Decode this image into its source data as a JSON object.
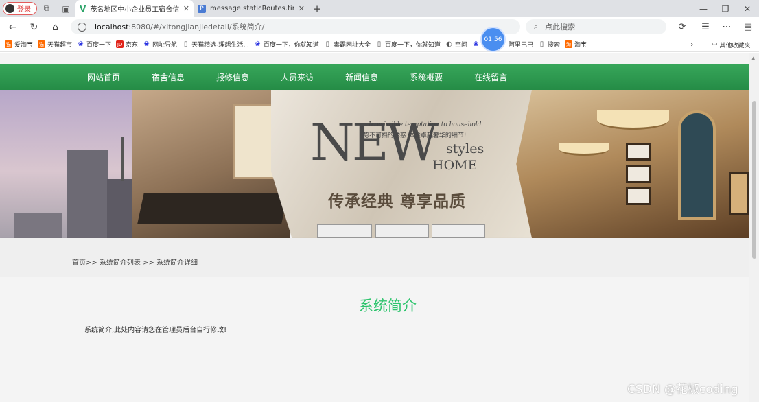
{
  "browser": {
    "login_label": "登录",
    "tabs": [
      {
        "title": "茂名地区中小企业员工宿舍信息管理",
        "active": true
      },
      {
        "title": "message.staticRoutes.tinymceEdit",
        "active": false
      }
    ],
    "url": {
      "host": "localhost",
      "path": ":8080/#/xitongjianjiedetail/系统简介/"
    },
    "search_placeholder": "点此搜索",
    "timer": "01:56",
    "bookmarks": [
      "爱淘宝",
      "天猫超市",
      "百度一下",
      "京东",
      "网址导航",
      "天猫精选-理想生活...",
      "百度一下，你就知道",
      "毒霸网址大全",
      "百度一下，你就知道",
      "空间",
      "百度",
      "阿里巴巴",
      "搜索",
      "淘宝"
    ],
    "other_bookmarks": "其他收藏夹"
  },
  "nav": {
    "items": [
      "网站首页",
      "宿舍信息",
      "报修信息",
      "人员来访",
      "新闻信息",
      "系统概要",
      "在线留言"
    ]
  },
  "banner": {
    "script": "Irresistible temptation to household",
    "slogan": "势不可挡的诱惑 体验卓越奢华的细节!",
    "new": "NEW",
    "styles": "styles",
    "home": "HOME",
    "cn": "传承经典 尊享品质"
  },
  "breadcrumb": "首页>> 系统简介列表 >> 系统简介详细",
  "content": {
    "title": "系统简介",
    "text": "系统简介,此处内容请您在管理员后台自行修改!"
  },
  "watermark": "CSDN @花椒coding"
}
